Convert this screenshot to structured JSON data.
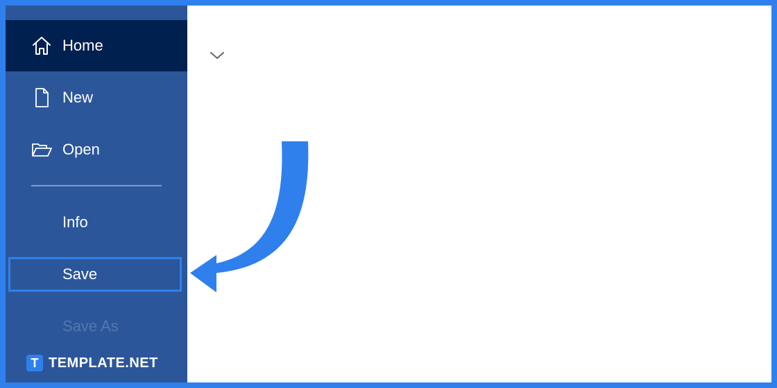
{
  "sidebar": {
    "items": [
      {
        "label": "Home",
        "icon": "home-icon",
        "active": true
      },
      {
        "label": "New",
        "icon": "new-document-icon"
      },
      {
        "label": "Open",
        "icon": "open-folder-icon"
      },
      {
        "label": "Info"
      },
      {
        "label": "Save",
        "highlighted": true
      },
      {
        "label": "Save As",
        "disabled": true
      }
    ]
  },
  "watermark": {
    "logo_letter": "T",
    "text": "TEMPLATE.NET"
  },
  "colors": {
    "frame": "#2f80ed",
    "sidebar_bg": "#2b579a",
    "active_bg": "#002050",
    "arrow": "#2f80ed",
    "highlight_border": "#2f80ed",
    "disabled_text": "#5377b0"
  }
}
